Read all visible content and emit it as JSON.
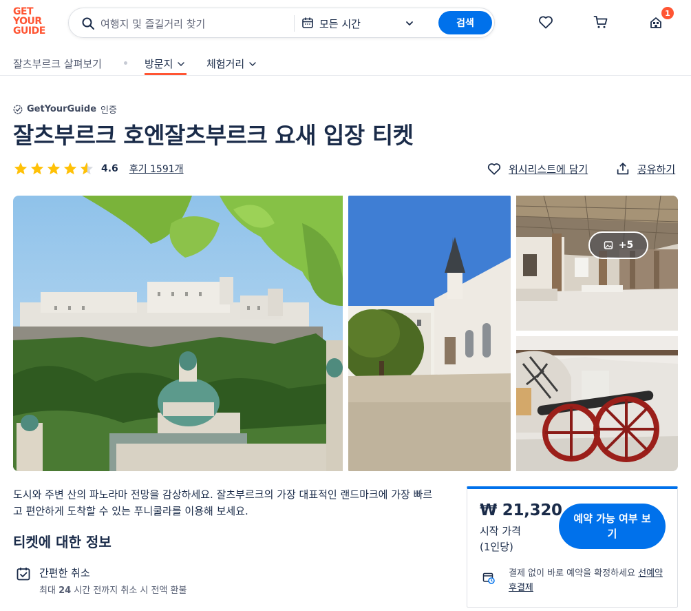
{
  "header": {
    "logo_lines": [
      "GET",
      "YOUR",
      "GUIDE"
    ],
    "search_placeholder": "여행지 및 즐길거리 찾기",
    "date_label": "모든 시간",
    "search_button": "검색",
    "cart_badge": "1",
    "icons": {
      "search": "search-icon",
      "calendar": "calendar-icon",
      "wishlist": "heart-icon",
      "cart": "cart-icon",
      "account": "account-icon"
    },
    "accent_color": "#0071eb",
    "brand_color": "#ff5533"
  },
  "subnav": {
    "explore": "잘츠부르크 살펴보기",
    "places": "방문지",
    "activities": "체험거리"
  },
  "product": {
    "certified_brand": "GetYourGuide",
    "certified_suffix": "인증",
    "title": "잘츠부르크 호엔잘츠부르크 요새 입장 티켓",
    "rating": "4.6",
    "rating_value": 4.6,
    "reviews": "후기 1591개",
    "wishlist": "위시리스트에 담기",
    "share": "공유하기",
    "more_photos": "+5"
  },
  "details": {
    "description": "도시와 주변 산의 파노라마 전망을 감상하세요. 잘츠부르크의 가장 대표적인 랜드마크에 가장 빠르고 편안하게 도착할 수 있는 푸니쿨라를 이용해 보세요.",
    "section_title": "티켓에 대한 정보",
    "feature_title": "간편한 취소",
    "feature_sub_pre": "최대",
    "feature_sub_hours": "24",
    "feature_sub_post": "시간 전까지 취소 시 전액 환불"
  },
  "booking": {
    "price": "₩ 21,320",
    "from_label": "시작 가격",
    "per_person": "(1인당)",
    "check_button": "예약 가능 여부 보기",
    "pay_text": "결제 없이 바로 예약을 확정하세요",
    "pay_link": "선예약 후결제"
  }
}
